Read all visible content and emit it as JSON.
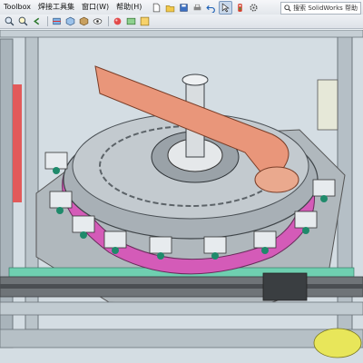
{
  "menubar": {
    "items": [
      {
        "label": "Toolbox"
      },
      {
        "label": "焊接工具集"
      },
      {
        "label": "窗口(W)"
      },
      {
        "label": "帮助(H)"
      }
    ],
    "search_label": "搜索 SolidWorks 帮助"
  },
  "toolbar": {
    "icons": [
      "new-icon",
      "open-icon",
      "save-icon",
      "print-icon",
      "undo-icon",
      "select-icon",
      "rebuild-icon",
      "options-icon"
    ]
  },
  "view_toolbar": {
    "icons": [
      "zoom-fit-icon",
      "zoom-area-icon",
      "previous-view-icon",
      "section-view-icon",
      "view-orientation-icon",
      "display-style-icon",
      "hide-show-icon",
      "appearance-icon",
      "scene-icon",
      "view-settings-icon"
    ]
  },
  "colors": {
    "base_plate": "#8c959c",
    "turntable": "#a8b0b6",
    "fixture_block": "#d45bb8",
    "arm": "#e9967a",
    "cylinder": "#1f8a6b",
    "frame": "#b9c3ca",
    "rail": "#70757a"
  }
}
